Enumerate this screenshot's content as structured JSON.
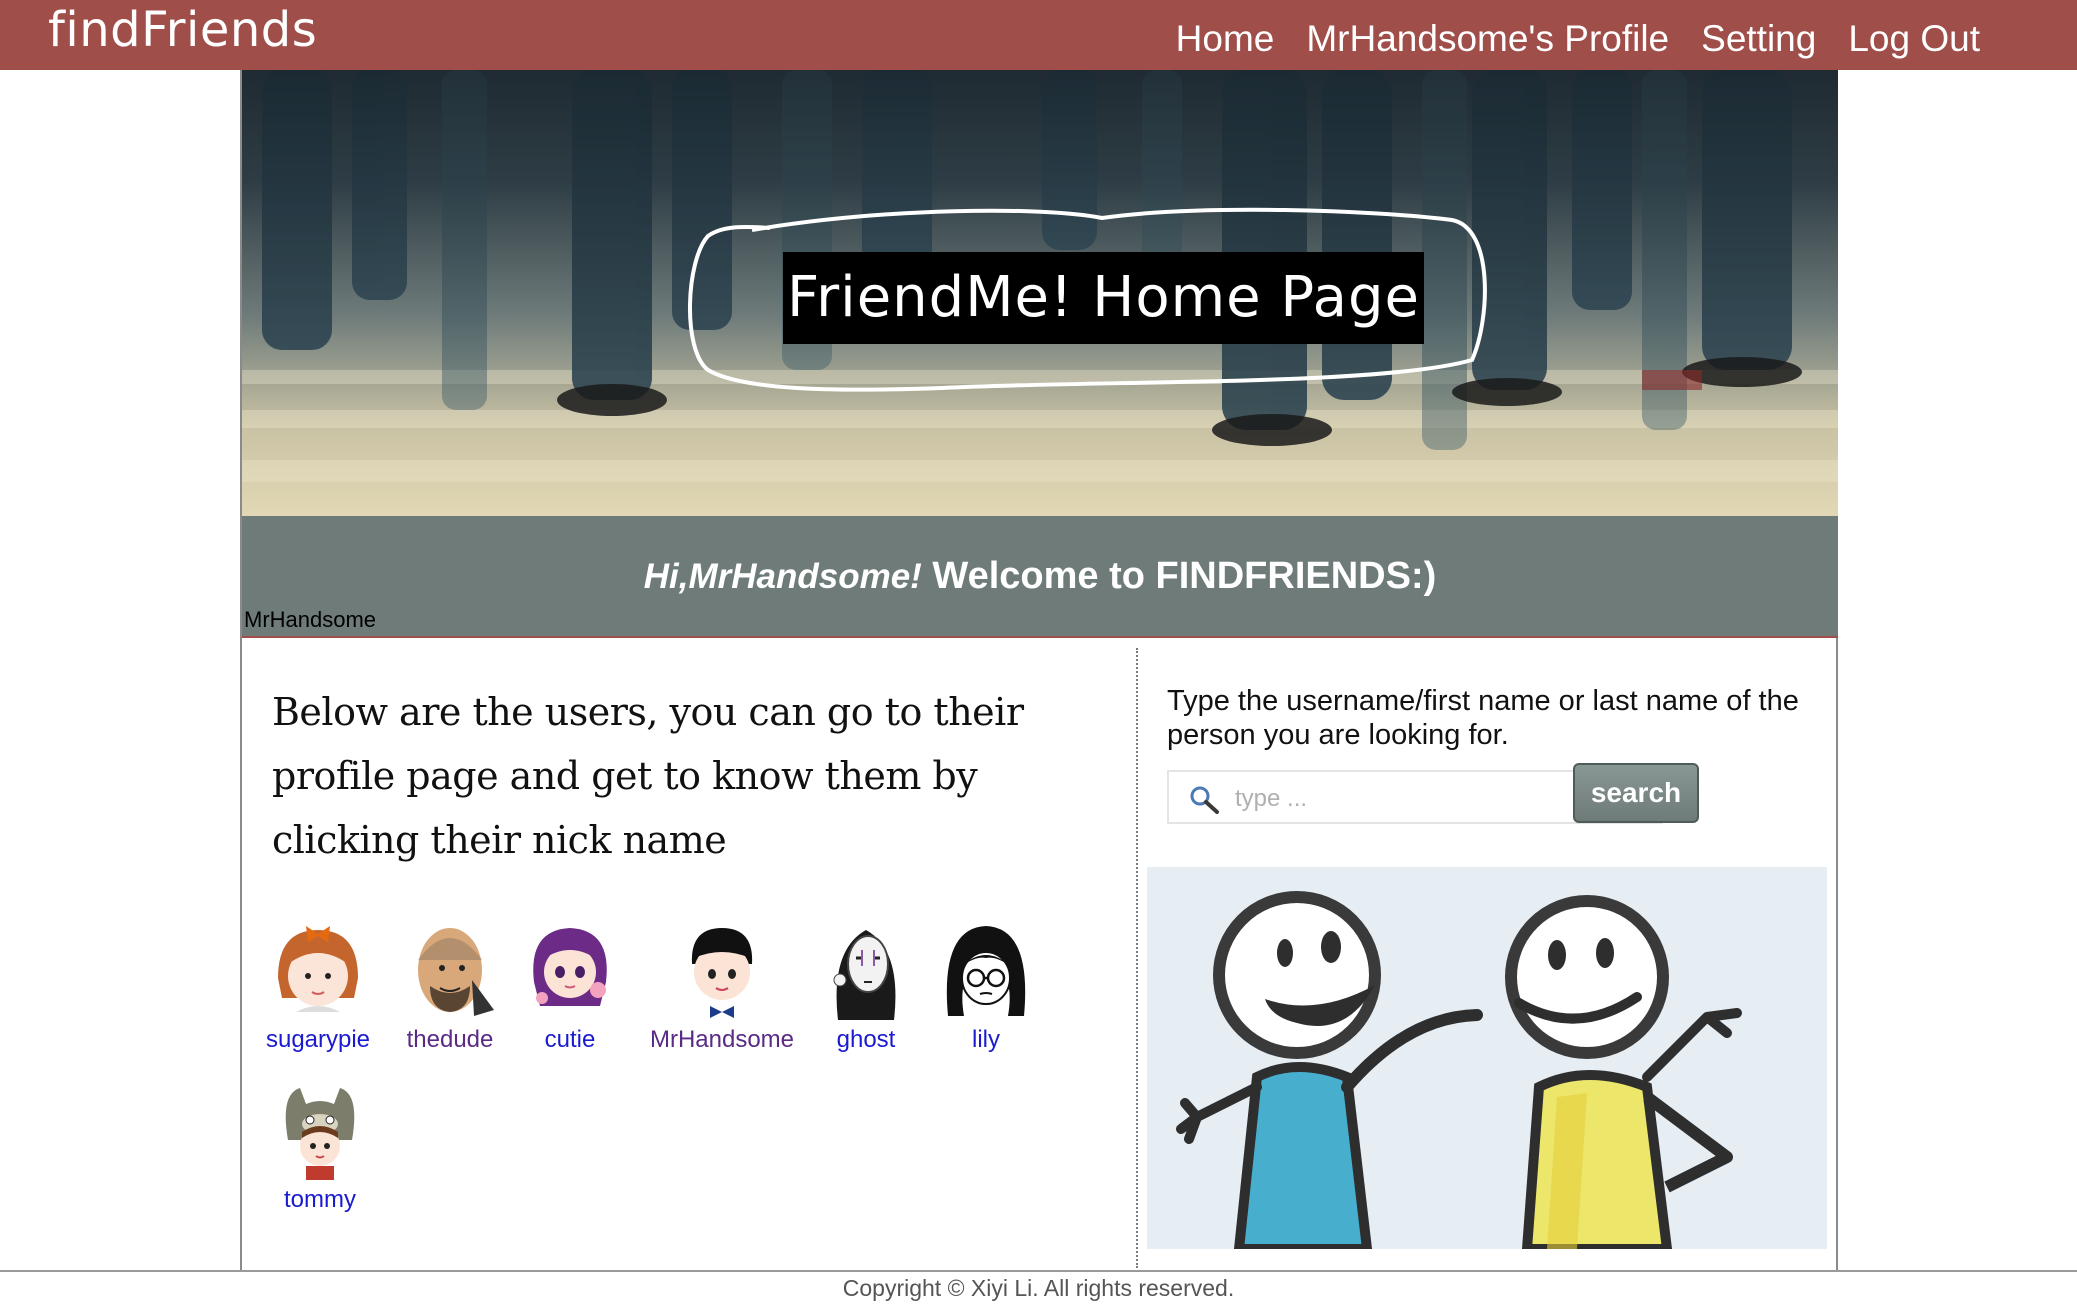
{
  "navbar": {
    "brand": "findFriends",
    "links": [
      "Home",
      "MrHandsome's Profile",
      "Setting",
      "Log Out"
    ],
    "color": "#a04e4a"
  },
  "hero": {
    "title": "FriendMe! Home Page"
  },
  "welcome": {
    "greeting": "Hi,MrHandsome!",
    "message": "Welcome to FINDFRIENDS:)",
    "username": "MrHandsome"
  },
  "users_section": {
    "intro": "Below are the users, you can go to their profile page and get to know them by clicking their nick name",
    "users": [
      {
        "name": "sugarypie",
        "avatar": "girl-orange-bow-avatar",
        "visited": false
      },
      {
        "name": "thedude",
        "avatar": "bald-dude-avatar",
        "visited": true
      },
      {
        "name": "cutie",
        "avatar": "purple-hair-girl-avatar",
        "visited": false
      },
      {
        "name": "MrHandsome",
        "avatar": "boy-bowtie-avatar",
        "visited": true
      },
      {
        "name": "ghost",
        "avatar": "masked-ghost-avatar",
        "visited": false
      },
      {
        "name": "lily",
        "avatar": "girl-glasses-avatar",
        "visited": false
      },
      {
        "name": "tommy",
        "avatar": "totoro-hat-kid-avatar",
        "visited": false
      }
    ]
  },
  "search": {
    "hint": "Type the username/first name or last name of the person you are looking for.",
    "placeholder": "type ...",
    "button_label": "search"
  },
  "footer": {
    "copyright": "Copyright © Xiyi Li. All rights reserved."
  }
}
